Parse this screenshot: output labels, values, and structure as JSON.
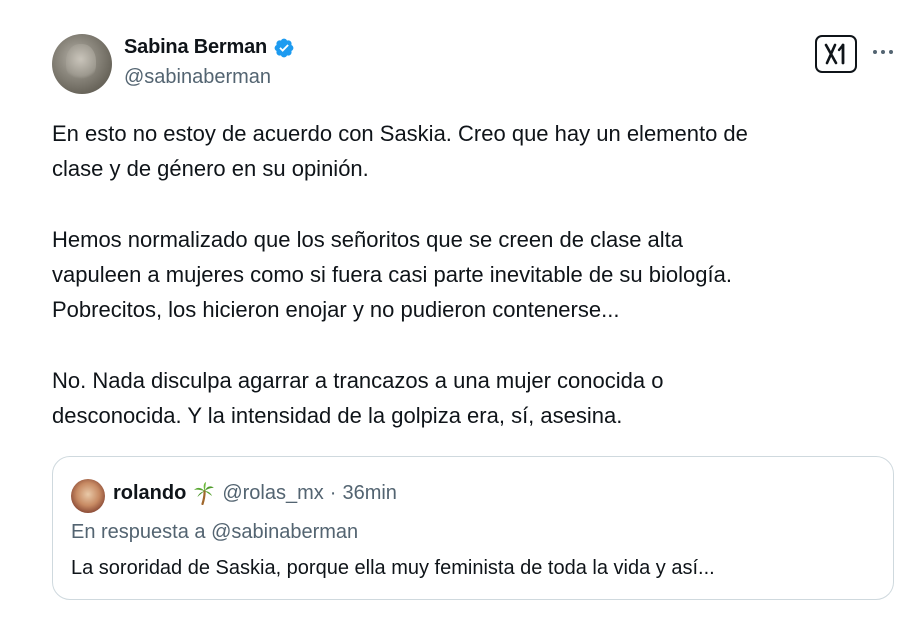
{
  "tweet": {
    "author_name": "Sabina Berman",
    "handle": "@sabinaberman",
    "paragraphs": [
      "En esto no estoy de acuerdo con Saskia. Creo que hay un elemento de\nclase y de género en su opinión.",
      "Hemos normalizado que los señoritos que se creen de clase alta\nvapuleen a mujeres como si fuera casi parte inevitable de su biología.\nPobrecitos, los hicieron enojar y no pudieron contenerse...",
      "No. Nada disculpa agarrar a trancazos a una mujer conocida o\ndesconocida. Y la intensidad de la golpiza era, sí, asesina."
    ]
  },
  "quoted": {
    "name": "rolando",
    "handle": "@rolas_mx",
    "separator": "·",
    "time": "36min",
    "reply_to": "En respuesta a @sabinaberman",
    "text": "La sororidad de Saskia, porque ella muy feminista de toda la vida y así..."
  },
  "icons": {
    "verified": "verified-badge-icon",
    "grok": "grok-icon",
    "more": "more-icon",
    "palm": "palm-tree-emoji-icon"
  },
  "colors": {
    "text": "#0f1419",
    "secondary": "#536471",
    "verified": "#1d9bf0",
    "border": "#cfd9de"
  }
}
